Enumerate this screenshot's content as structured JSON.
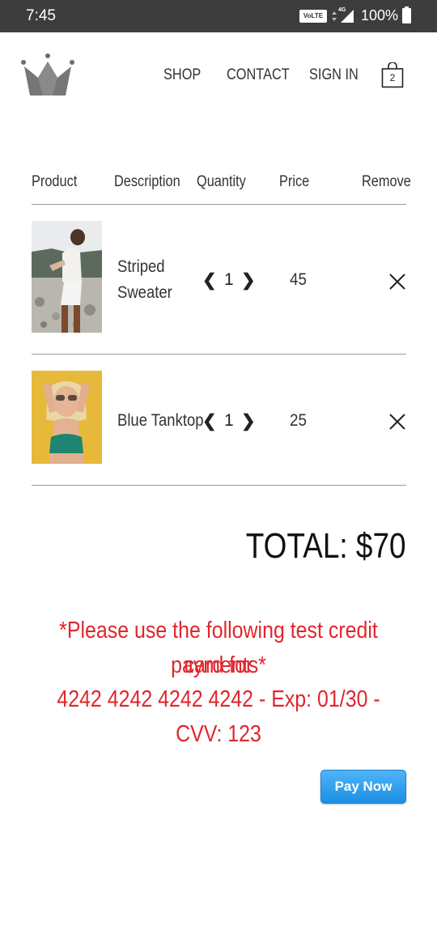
{
  "status_bar": {
    "time": "7:45",
    "volte": "VoLTE",
    "network": "4G",
    "battery": "100%"
  },
  "nav": {
    "shop": "SHOP",
    "contact": "CONTACT",
    "sign_in": "SIGN IN",
    "cart_count": "2"
  },
  "table": {
    "headers": {
      "product": "Product",
      "description": "Description",
      "quantity": "Quantity",
      "price": "Price",
      "remove": "Remove"
    },
    "items": [
      {
        "description_line1": "Striped",
        "description_line2": "Sweater",
        "quantity": "1",
        "price": "45",
        "qty_dec": "❮",
        "qty_inc": "❯"
      },
      {
        "description_line1": "Blue Tanktop",
        "quantity": "1",
        "price": "25",
        "qty_dec": "❮",
        "qty_inc": "❯"
      }
    ]
  },
  "total": "TOTAL: $70",
  "notice": {
    "line1": "*Please use the following test credit card for",
    "line2": "payments*",
    "line3": "4242 4242 4242 4242 - Exp: 01/30 - CVV: 123"
  },
  "pay_button": "Pay Now",
  "colors": {
    "status_bar": "#3d3d3d",
    "notice_red": "#e0262d",
    "pay_button_blue": "#1c8fe4"
  }
}
